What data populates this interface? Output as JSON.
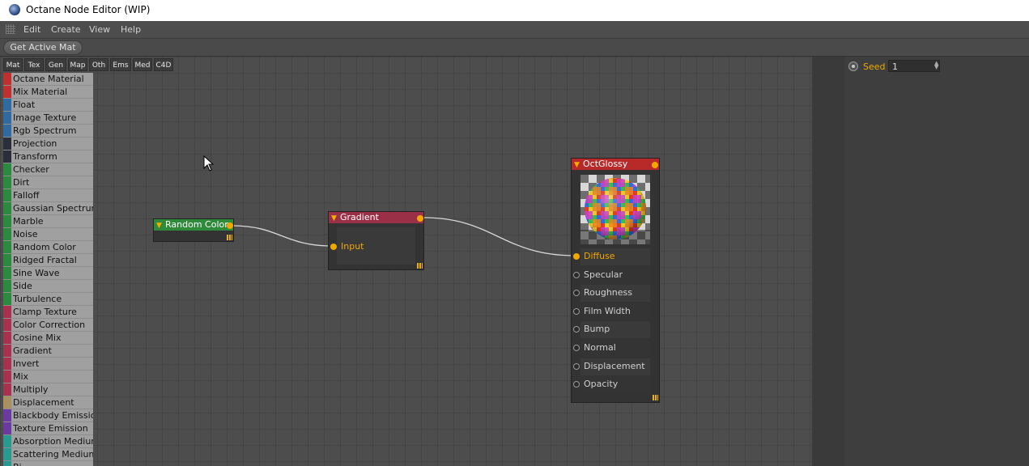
{
  "window": {
    "title": "Octane Node Editor (WIP)"
  },
  "menu": [
    "Edit",
    "Create",
    "View",
    "Help"
  ],
  "toolbar": {
    "get_active_mat": "Get Active Mat"
  },
  "tabs": [
    "Mat",
    "Tex",
    "Gen",
    "Map",
    "Oth",
    "Ems",
    "Med",
    "C4D"
  ],
  "palette": [
    {
      "label": "Octane Material",
      "color": "#c0302e"
    },
    {
      "label": "Mix Material",
      "color": "#c0302e"
    },
    {
      "label": "Float",
      "color": "#2f6aa0"
    },
    {
      "label": "Image Texture",
      "color": "#2f6aa0"
    },
    {
      "label": "Rgb Spectrum",
      "color": "#2f6aa0"
    },
    {
      "label": "Projection",
      "color": "#2a2e3a"
    },
    {
      "label": "Transform",
      "color": "#2a2e3a"
    },
    {
      "label": "Checker",
      "color": "#2a8a3e"
    },
    {
      "label": "Dirt",
      "color": "#2a8a3e"
    },
    {
      "label": "Falloff",
      "color": "#2a8a3e"
    },
    {
      "label": "Gaussian Spectrum",
      "color": "#2a8a3e"
    },
    {
      "label": "Marble",
      "color": "#2a8a3e"
    },
    {
      "label": "Noise",
      "color": "#2a8a3e"
    },
    {
      "label": "Random Color",
      "color": "#2a8a3e"
    },
    {
      "label": "Ridged Fractal",
      "color": "#2a8a3e"
    },
    {
      "label": "Sine Wave",
      "color": "#2a8a3e"
    },
    {
      "label": "Side",
      "color": "#2a8a3e"
    },
    {
      "label": "Turbulence",
      "color": "#2a8a3e"
    },
    {
      "label": "Clamp Texture",
      "color": "#a8324e"
    },
    {
      "label": "Color Correction",
      "color": "#a8324e"
    },
    {
      "label": "Cosine Mix",
      "color": "#a8324e"
    },
    {
      "label": "Gradient",
      "color": "#a8324e"
    },
    {
      "label": "Invert",
      "color": "#a8324e"
    },
    {
      "label": "Mix",
      "color": "#a8324e"
    },
    {
      "label": "Multiply",
      "color": "#a8324e"
    },
    {
      "label": "Displacement",
      "color": "#a89060"
    },
    {
      "label": "Blackbody Emission",
      "color": "#6a3aa0"
    },
    {
      "label": "Texture Emission",
      "color": "#6a3aa0"
    },
    {
      "label": "Absorption Medium",
      "color": "#2a9a90"
    },
    {
      "label": "Scattering Medium",
      "color": "#2a9a90"
    },
    {
      "label": "Bi...",
      "color": "#2a9a90"
    }
  ],
  "seed": {
    "label": "Seed",
    "value": "1"
  },
  "nodes": {
    "random_color": {
      "title": "Random Color",
      "color": "#2f8a3a"
    },
    "gradient": {
      "title": "Gradient",
      "color": "#9a3048",
      "inputs": [
        "Input"
      ]
    },
    "octglossy": {
      "title": "OctGlossy",
      "color": "#b82a2a",
      "inputs": [
        "Diffuse",
        "Specular",
        "Roughness",
        "Film Width",
        "Bump",
        "Normal",
        "Displacement",
        "Opacity"
      ]
    }
  }
}
